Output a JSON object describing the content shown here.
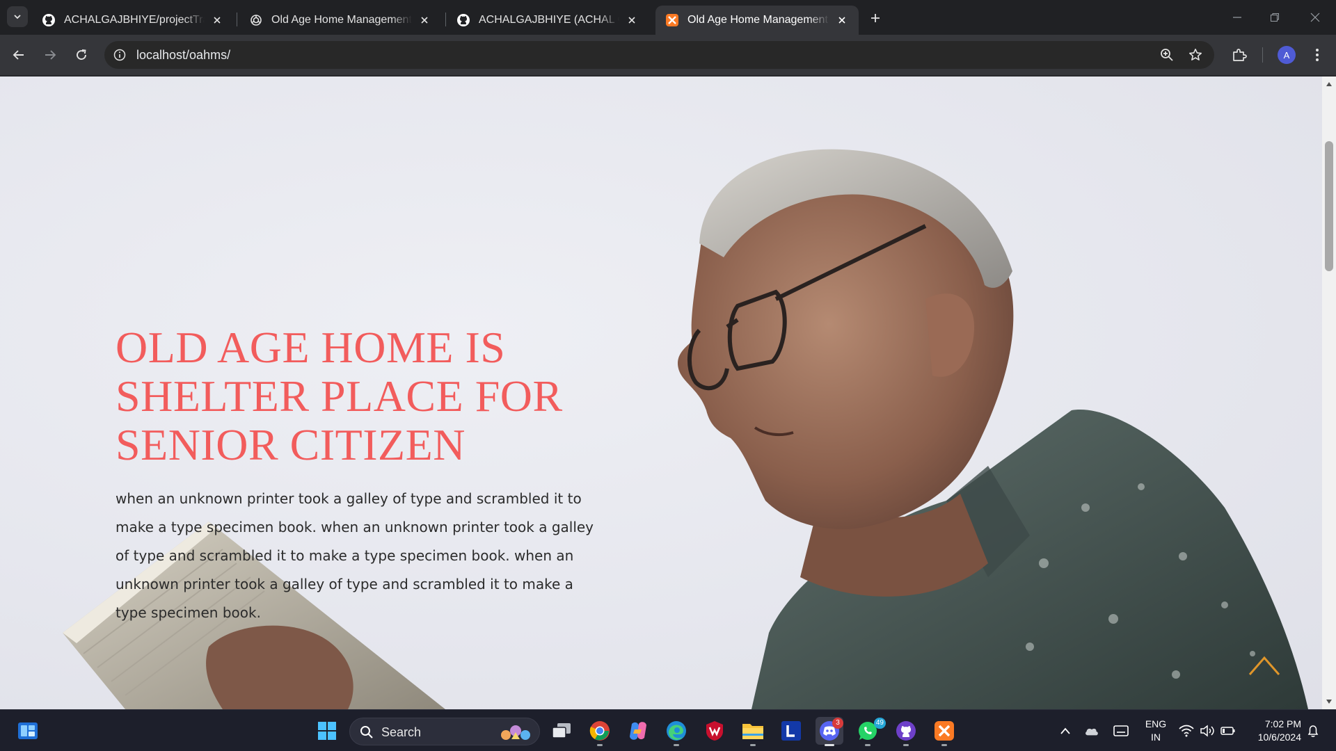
{
  "browser": {
    "tabs": [
      {
        "title": "ACHALGAJBHIYE/projectTravell",
        "icon": "github-icon",
        "active": false
      },
      {
        "title": "Old Age Home Management",
        "icon": "openai-icon",
        "active": false
      },
      {
        "title": "ACHALGAJBHIYE (ACHAL GAJBHIYE)",
        "icon": "github-icon",
        "active": false
      },
      {
        "title": "Old Age Home Management System",
        "icon": "xampp-icon",
        "active": true
      }
    ],
    "url": "localhost/oahms/",
    "profile_initial": "A",
    "colors": {
      "frame": "#202124",
      "toolbar": "#35363a",
      "omnibox": "#282828"
    }
  },
  "page": {
    "hero": {
      "title": "OLD AGE HOME IS SHELTER PLACE FOR SENIOR CITIZEN",
      "description": "when an unknown printer took a galley of type and scrambled it to make a type specimen book. when an unknown printer took a galley of type and scrambled it to make a type specimen book. when an unknown printer took a galley of type and scrambled it to make a type specimen book.",
      "image": "elderly-man-with-glasses-reading-newspaper",
      "colors": {
        "title": "#f25c5c",
        "text": "#2b2b2b",
        "scroll_top_arrow": "#e0962a"
      }
    },
    "scroll_top_icon": "chevron-up-icon"
  },
  "taskbar": {
    "search_label": "Search",
    "apps": [
      {
        "name": "start",
        "icon": "windows-start-icon"
      },
      {
        "name": "task-view",
        "icon": "task-view-icon"
      },
      {
        "name": "chrome",
        "icon": "chrome-icon"
      },
      {
        "name": "copilot",
        "icon": "copilot-icon"
      },
      {
        "name": "edge",
        "icon": "edge-icon"
      },
      {
        "name": "mcafee",
        "icon": "mcafee-icon"
      },
      {
        "name": "file-explorer",
        "icon": "folder-icon"
      },
      {
        "name": "l-app",
        "icon": "l-app-icon",
        "letter": "L"
      },
      {
        "name": "discord",
        "icon": "discord-icon",
        "badge": "3"
      },
      {
        "name": "whatsapp",
        "icon": "whatsapp-icon",
        "badge": "49"
      },
      {
        "name": "github-desktop",
        "icon": "github-desktop-icon"
      },
      {
        "name": "xampp",
        "icon": "xampp-icon"
      }
    ],
    "language": {
      "line1": "ENG",
      "line2": "IN"
    },
    "time": "7:02 PM",
    "date": "10/6/2024"
  }
}
